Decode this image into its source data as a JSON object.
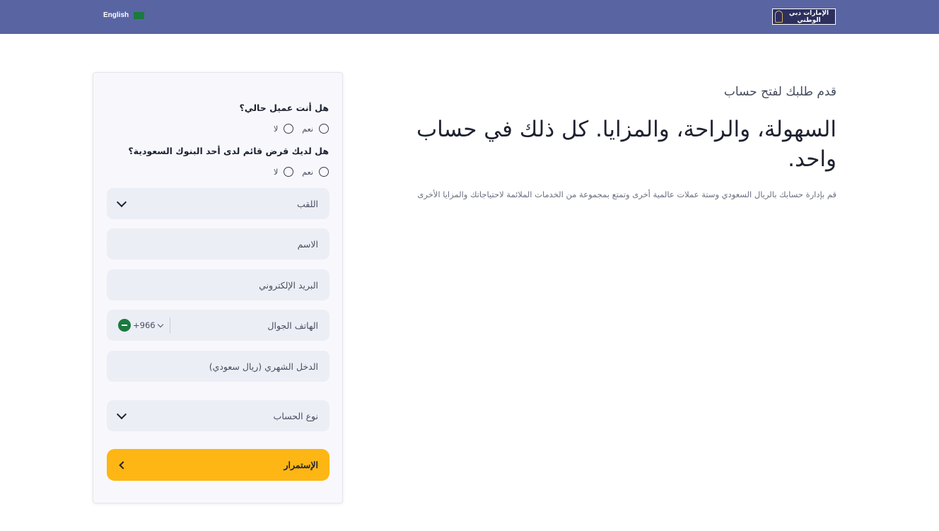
{
  "header": {
    "language_label": "English",
    "logo_text": "الإمارات دبي الوطني",
    "background_color": "#5965a3"
  },
  "hero": {
    "kicker": "قدم طلبك لفتح حساب",
    "title": "السهولة، والراحة، والمزايا. كل ذلك في حساب واحد.",
    "description": "قم بإدارة حسابك بالريال السعودي وستة عملات عالمية أخرى وتمتع بمجموعة من الخدمات الملائمة لاحتياجاتك والمزايا الأخرى"
  },
  "form": {
    "question_existing_customer": "هل أنت عميل حالي؟",
    "question_existing_loan": "هل لديك قرض قائم لدى أحد البنوك السعودية؟",
    "option_yes": "نعم",
    "option_no": "لا",
    "title_placeholder": "اللقب",
    "name_placeholder": "الاسم",
    "email_placeholder": "البريد الإلكتروني",
    "phone_placeholder": "الهاتف الجوال",
    "phone_code": "+966",
    "income_placeholder": "الدخل الشهري (ريال سعودي)",
    "account_type_placeholder": "نوع الحساب",
    "submit_label": "الإستمرار",
    "submit_color": "#fdb614"
  }
}
